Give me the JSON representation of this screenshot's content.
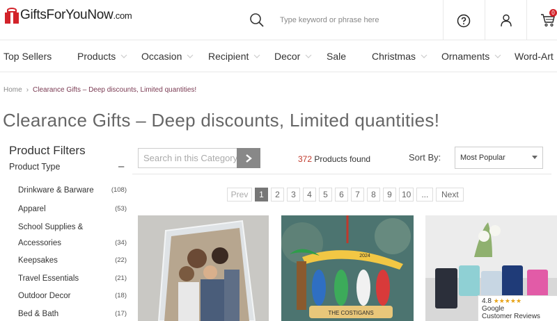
{
  "header": {
    "logo_text": "GiftsForYouNow",
    "logo_suffix": ".com",
    "search_placeholder": "Type keyword or phrase here",
    "cart_count": "0"
  },
  "nav": {
    "items": [
      {
        "label": "Top Sellers"
      },
      {
        "label": "Products"
      },
      {
        "label": "Occasion"
      },
      {
        "label": "Recipient"
      },
      {
        "label": "Decor"
      },
      {
        "label": "Sale"
      },
      {
        "label": "Christmas"
      },
      {
        "label": "Ornaments"
      },
      {
        "label": "Word-Art"
      }
    ]
  },
  "breadcrumb": {
    "home": "Home",
    "current": "Clearance Gifts – Deep discounts, Limited quantities!"
  },
  "page_title": "Clearance Gifts – Deep discounts, Limited quantities!",
  "filters": {
    "title": "Product Filters",
    "group_label": "Product Type",
    "toggle": "–",
    "items": [
      {
        "label": "Drinkware & Barware",
        "count": "(108)"
      },
      {
        "label": "Apparel",
        "count": "(53)"
      },
      {
        "label_line1": "School Supplies &",
        "label_line2": "Accessories",
        "count": "(34)"
      },
      {
        "label": "Keepsakes",
        "count": "(22)"
      },
      {
        "label": "Travel Essentials",
        "count": "(21)"
      },
      {
        "label": "Outdoor Decor",
        "count": "(18)"
      },
      {
        "label": "Bed & Bath",
        "count": "(17)"
      }
    ]
  },
  "toolbar": {
    "search_placeholder": "Search in this Category",
    "products_count": "372",
    "products_found_label": "Products found",
    "sort_label": "Sort By:",
    "sort_value": "Most Popular"
  },
  "pagination": {
    "prev": "Prev",
    "pages": [
      "1",
      "2",
      "3",
      "4",
      "5",
      "6",
      "7",
      "8",
      "9",
      "10"
    ],
    "dots": "...",
    "next": "Next",
    "current": "1"
  },
  "products": {
    "ornament_name_text": "THE COSTIGANS",
    "ornament_year_text": "2024"
  },
  "google_reviews": {
    "rating": "4.8",
    "stars": "★★★★★",
    "brand": "Google",
    "label": "Customer Reviews"
  },
  "colors": {
    "brand_red": "#d2232a",
    "breadcrumb_current": "#7a3a52",
    "count_red": "#c0392b"
  }
}
